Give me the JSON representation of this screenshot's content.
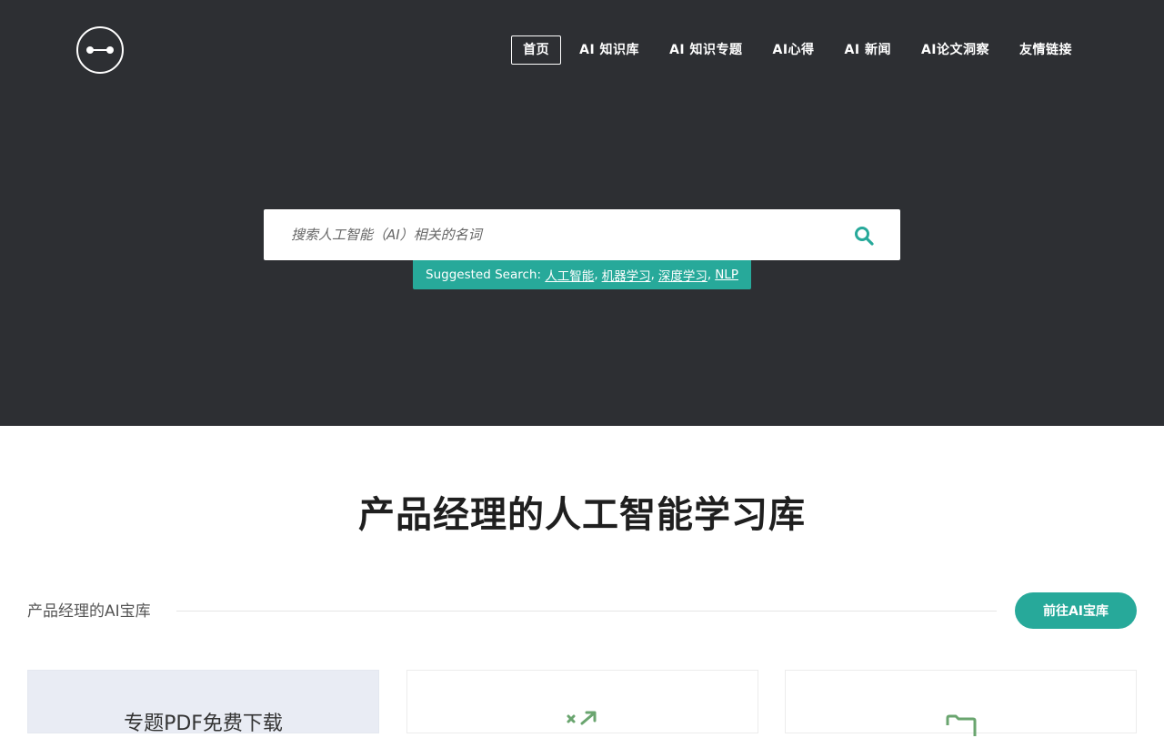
{
  "nav": {
    "items": [
      {
        "label": "首页",
        "active": true
      },
      {
        "label": "AI 知识库",
        "active": false
      },
      {
        "label": "AI 知识专题",
        "active": false
      },
      {
        "label": "AI心得",
        "active": false
      },
      {
        "label": "AI 新闻",
        "active": false
      },
      {
        "label": "AI论文洞察",
        "active": false
      },
      {
        "label": "友情链接",
        "active": false
      }
    ]
  },
  "search": {
    "placeholder": "搜索人工智能（AI）相关的名词",
    "icon": "search-icon"
  },
  "suggest": {
    "prefix": "Suggested Search:",
    "links": [
      "人工智能",
      "机器学习",
      "深度学习",
      "NLP"
    ]
  },
  "main": {
    "title": "产品经理的人工智能学习库"
  },
  "section": {
    "label": "产品经理的AI宝库",
    "button": "前往AI宝库"
  },
  "cards": [
    {
      "title": "专题PDF免费下载",
      "icon": null
    },
    {
      "title": "",
      "icon": "shuffle-arrows-icon"
    },
    {
      "title": "",
      "icon": "folder-icon"
    }
  ],
  "colors": {
    "hero_bg": "#2d2f33",
    "accent": "#27a99a",
    "icon_green": "#6aa56f"
  }
}
